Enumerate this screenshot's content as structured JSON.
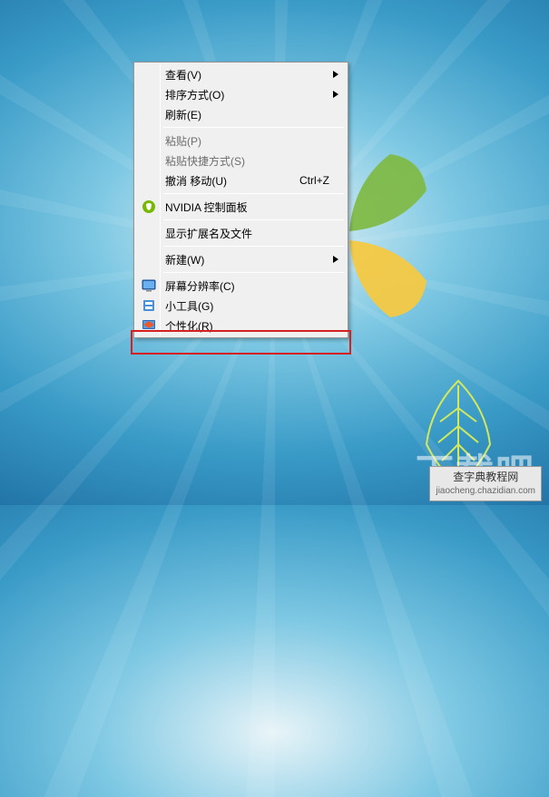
{
  "menu": {
    "view": {
      "label": "查看(V)",
      "has_submenu": true
    },
    "sort": {
      "label": "排序方式(O)",
      "has_submenu": true
    },
    "refresh": {
      "label": "刷新(E)"
    },
    "paste": {
      "label": "粘贴(P)",
      "disabled": true
    },
    "paste_shortcut": {
      "label": "粘贴快捷方式(S)",
      "disabled": true
    },
    "undo_move": {
      "label": "撤消 移动(U)",
      "shortcut": "Ctrl+Z"
    },
    "nvidia": {
      "label": "NVIDIA 控制面板",
      "icon": "nvidia-icon"
    },
    "show_ext": {
      "label": "显示扩展名及文件"
    },
    "new": {
      "label": "新建(W)",
      "has_submenu": true
    },
    "resolution": {
      "label": "屏幕分辨率(C)",
      "icon": "monitor-icon"
    },
    "gadgets": {
      "label": "小工具(G)",
      "icon": "gadget-icon"
    },
    "personalize": {
      "label": "个性化(R)",
      "icon": "personalize-icon",
      "highlighted": true
    }
  },
  "watermark": {
    "big": "下载吧",
    "title": "查字典教程网",
    "url": "jiaocheng.chazidian.com"
  }
}
